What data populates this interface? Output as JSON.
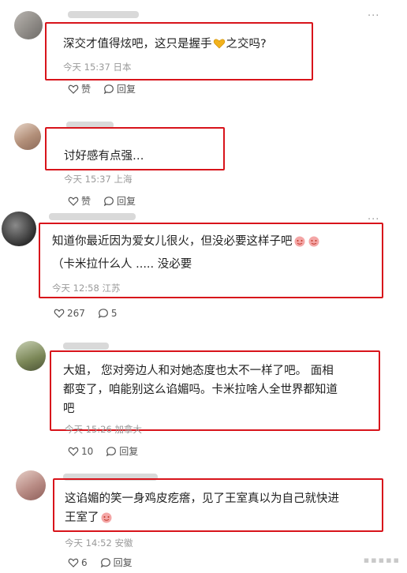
{
  "comments": [
    {
      "text": "深交才值得炫吧，这只是握手",
      "text_after": "之交吗?",
      "emoji": "yellow-heart",
      "time": "今天 15:37",
      "location": "日本",
      "like_label": "赞",
      "reply_label": "回复"
    },
    {
      "text": "讨好感有点强…",
      "time": "今天 15:37",
      "location": "上海",
      "like_label": "赞",
      "reply_label": "回复"
    },
    {
      "line1": "知道你最近因为爱女儿很火，但没必要这样子吧",
      "line2": "（卡米拉什么人 ..... 没必要",
      "emoji": "smiling-face",
      "time": "今天 12:58",
      "location": "江苏",
      "like_count": "267",
      "reply_count": "5"
    },
    {
      "line1": "大姐，  您对旁边人和对她态度也太不一样了吧。  面相",
      "line2": "都变了，咱能别这么谄媚吗。卡米拉啥人全世界都知道",
      "line3": "吧",
      "time": "今天 15:26",
      "location": "加拿大",
      "like_count": "10",
      "reply_label": "回复"
    },
    {
      "line1": "这谄媚的笑一身鸡皮疙瘩，见了王室真以为自己就快进",
      "line2": "王室了",
      "emoji": "smiling-face",
      "time": "今天 14:52",
      "location": "安徽",
      "like_count": "6",
      "reply_label": "回复"
    }
  ],
  "colors": {
    "highlight": "#d8141b",
    "meta": "#9a9a9a",
    "text": "#1f1f1f"
  }
}
